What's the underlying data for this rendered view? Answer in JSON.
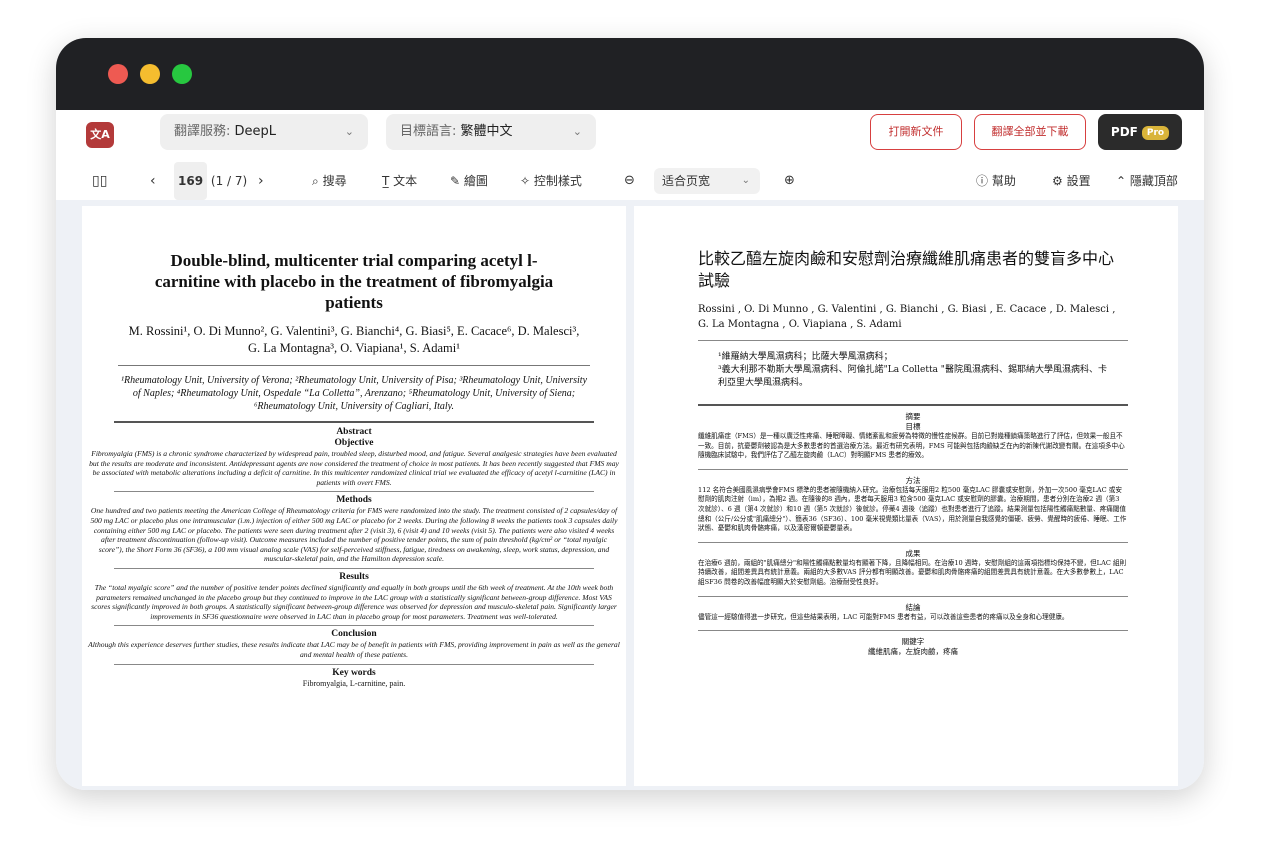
{
  "app": {
    "traffic_colors": [
      "#ee5a52",
      "#f5bd2f",
      "#27c840"
    ],
    "logo_text": "文A"
  },
  "toolbar": {
    "service_label": "翻譯服務:",
    "service_value": "DeepL",
    "target_label": "目標語言:",
    "target_value": "繁體中文",
    "open_new": "打開新文件",
    "translate_all": "翻譯全部並下載",
    "pdf_label": "PDF",
    "pro_badge": "Pro",
    "accent": "#d74040"
  },
  "nav": {
    "page_input": "169",
    "page_count": "(1 / 7)",
    "search": "搜尋",
    "text": "文本",
    "draw": "繪圖",
    "control_style": "控制樣式",
    "zoom_value": "适合页宽",
    "help": "幫助",
    "settings": "設置",
    "hide_top": "隱藏頂部"
  },
  "original": {
    "title": "Double-blind, multicenter trial comparing acetyl l-carnitine with placebo in the treatment of fibromyalgia patients",
    "authors": "M. Rossini¹, O. Di Munno², G. Valentini³, G. Bianchi⁴, G. Biasi⁵, E. Cacace⁶, D. Malesci³, G. La Montagna³, O. Viapiana¹, S. Adami¹",
    "affiliations": "¹Rheumatology Unit, University of Verona; ²Rheumatology Unit, University of Pisa; ³Rheumatology Unit, University of Naples; ⁴Rheumatology Unit, Ospedale “La Colletta”, Arenzano; ⁵Rheumatology Unit, University of Siena; ⁶Rheumatology Unit, University of Cagliari, Italy.",
    "abstract_heading": "Abstract",
    "objective_heading": "Objective",
    "objective": "Fibromyalgia (FMS) is a chronic syndrome characterized by widespread pain, troubled sleep, disturbed mood, and fatigue. Several analgesic strategies have been evaluated but the results are moderate and inconsistent. Antidepressant agents are now considered the treatment of choice in most patients. It has been recently suggested that FMS may be associated with metabolic alterations including a deficit of carnitine. In this multicenter randomized clinical trial we evaluated the efficacy of acetyl l-carnitine (LAC) in patients with overt FMS.",
    "methods_heading": "Methods",
    "methods": "One hundred and two patients meeting the American College of Rheumatology criteria for FMS were randomized into the study. The treatment consisted of 2 capsules/day of 500 mg LAC or placebo plus one intramuscular (i.m.) injection of either 500 mg LAC or placebo for 2 weeks. During the following 8 weeks the patients took 3 capsules daily containing either 500 mg LAC or placebo. The patients were seen during treatment after 2 (visit 3), 6 (visit 4) and 10 weeks (visit 5). The patients were also visited 4 weeks after treatment discontinuation (follow-up visit). Outcome measures included the number of positive tender points, the sum of pain threshold (kg/cm² or “total myalgic score”), the Short Form 36 (SF36), a 100 mm visual analog scale (VAS) for self-perceived stiffness, fatigue, tiredness on awakening, sleep, work status, depression, and muscular-skeletal pain, and the Hamilton depression scale.",
    "results_heading": "Results",
    "results": "The “total myalgic score” and the number of positive tender points declined significantly and equally in both groups until the 6th week of treatment. At the 10th week both parameters remained unchanged in the placebo group but they continued to improve in the LAC group with a statistically significant between-group difference. Most VAS scores significantly improved in both groups. A statistically significant between-group difference was observed for depression and musculo-skeletal pain. Significantly larger improvements in SF36 questionnaire were observed in LAC than in placebo group for most parameters. Treatment was well-tolerated.",
    "conclusion_heading": "Conclusion",
    "conclusion": "Although this experience deserves further studies, these results indicate that LAC may be of benefit in patients with FMS, providing improvement in pain as well as the general and mental health of these patients.",
    "keywords_heading": "Key words",
    "keywords": "Fibromyalgia, L-carnitine, pain."
  },
  "translated": {
    "title": "比較乙醯左旋肉鹼和安慰劑治療纖維肌痛患者的雙盲多中心試驗",
    "authors": "Rossini , O. Di Munno , G. Valentini , G. Bianchi , G. Biasi , E. Cacace , D. Malesci , G. La Montagna , O. Viapiana , S. Adami",
    "affil1": "¹維羅納大學風濕病科；比薩大學風濕病科；",
    "affil2": "³義大利那不勒斯大學風濕病科、阿倫扎諾\"La Colletta \"醫院風濕病科、錫耶納大學風濕病科、卡利亞里大學風濕病科。",
    "abstract_heading": "摘要",
    "objective_heading": "目標",
    "objective": "纖維肌痛症（FMS）是一種以廣泛性疼痛、睡眠障礙、情緒紊亂和疲勞為特徵的慢性症候群。目前已對幾種鎮痛策略進行了評估，但效果一般且不一致。目前，抗憂鬱劑被認為是大多數患者的首選治療方法。最近有研究表明，FMS 可能與包括肉鹼缺乏在內的新陳代謝改變有關。在這項多中心隨機臨床試驗中，我們評估了乙醯左旋肉鹼（LAC）對明顯FMS 患者的療效。",
    "methods_heading": "方法",
    "methods": "112 名符合美國風濕病學會FMS 標準的患者被隨機納入研究。治療包括每天服用2 粒500 毫克LAC 膠囊或安慰劑，外加一次500 毫克LAC 或安慰劑的肌肉注射（im），為期2 週。在隨後的8 週內，患者每天服用3 粒含500 毫克LAC 或安慰劑的膠囊。治療期間，患者分別在治療2 週（第3 次就診）、6 週（第4 次就診）和10 週（第5 次就診）後就診。停藥4 週後（追蹤）也對患者進行了追蹤。結果測量包括陽性觸痛點數量、疼痛閾值總和（公斤/公分或\"肌痛總分\"）、簡表36（SF36）、100 毫米視覺類比量表（VAS），用於測量自我感覺的僵硬、疲勞、覺醒時的疲倦、睡眠、工作狀態、憂鬱和肌肉骨骼疼痛，以及漢密爾頓憂鬱量表。",
    "results_heading": "成果",
    "results": "在治療6 週前，兩組的\"肌痛總分\"和陽性觸痛點數量均有顯著下降，且降幅相同。在治療10 週時，安慰劑組的這兩項指標均保持不變，但LAC 組則持續改善，組間差異具有統計意義。兩組的大多數VAS 評分都有明顯改善。憂鬱和肌肉骨骼疼痛的組間差異具有統計意義。在大多數參數上，LAC 組SF36 問卷的改善幅度明顯大於安慰劑組。治療耐受性良好。",
    "conclusion_heading": "結論",
    "conclusion": "儘管這一經驗值得進一步研究，但這些結果表明，LAC 可能對FMS 患者有益，可以改善這些患者的疼痛以及全身和心理健康。",
    "keywords_heading": "關鍵字",
    "keywords": "纖維肌痛，左旋肉鹼，疼痛"
  }
}
